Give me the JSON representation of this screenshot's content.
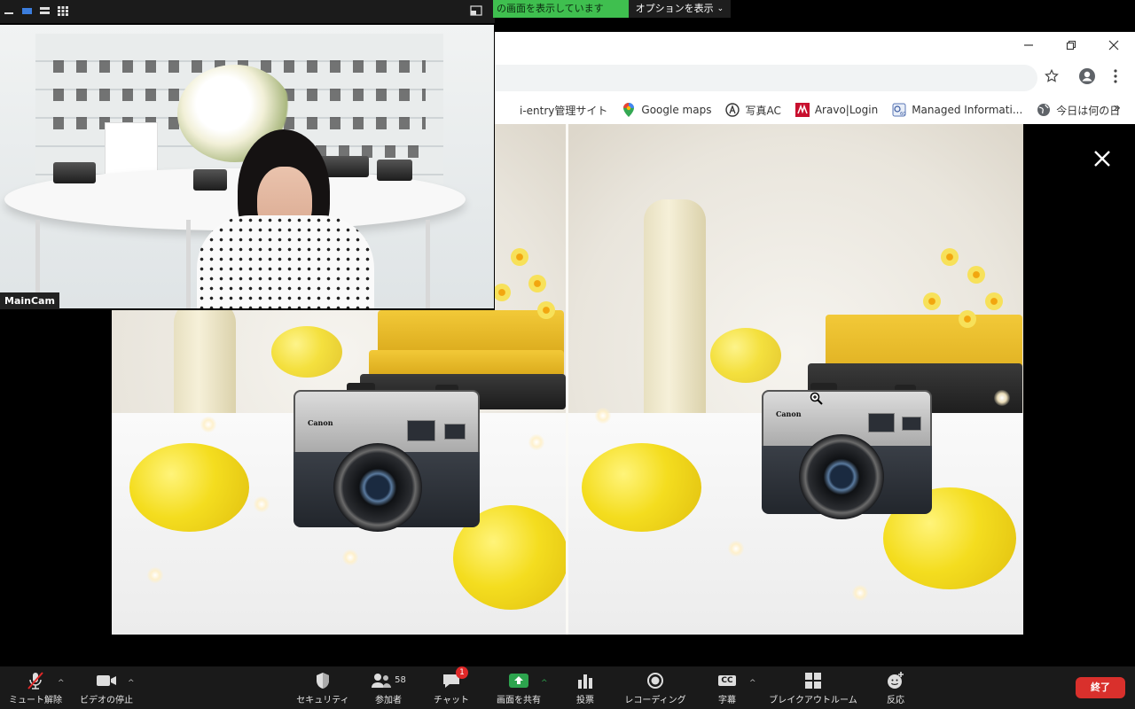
{
  "share_banner": {
    "status": "の画面を表示しています",
    "options": "オプションを表示",
    "accent": "#3fbf4f"
  },
  "browser": {
    "window_controls": [
      "minimize-icon",
      "restore-icon",
      "close-icon"
    ],
    "bookmarks": [
      {
        "label": "i-entry管理サイト",
        "icon": "bookmark-icon"
      },
      {
        "label": "Google maps",
        "icon": "map-pin-icon"
      },
      {
        "label": "写真AC",
        "icon": "photoac-icon"
      },
      {
        "label": "Aravo|Login",
        "icon": "aravo-icon"
      },
      {
        "label": "Managed Informati...",
        "icon": "info-icon"
      },
      {
        "label": "今日は何の日",
        "icon": "globe-icon"
      }
    ],
    "more": "»"
  },
  "video": {
    "name_tag": "MainCam"
  },
  "slide": {
    "brand_text": "Canon"
  },
  "toolbar": {
    "mute": "ミュート解除",
    "video": "ビデオの停止",
    "security": "セキュリティ",
    "participants": "参加者",
    "participants_count": "58",
    "chat": "チャット",
    "chat_badge": "1",
    "share": "画面を共有",
    "poll": "投票",
    "record": "レコーディング",
    "captions": "字幕",
    "cc": "CC",
    "breakout": "ブレイクアウトルーム",
    "reactions": "反応",
    "end": "終了",
    "colors": {
      "share": "#2da44e",
      "end": "#d9302c",
      "badge": "#e02828"
    }
  }
}
